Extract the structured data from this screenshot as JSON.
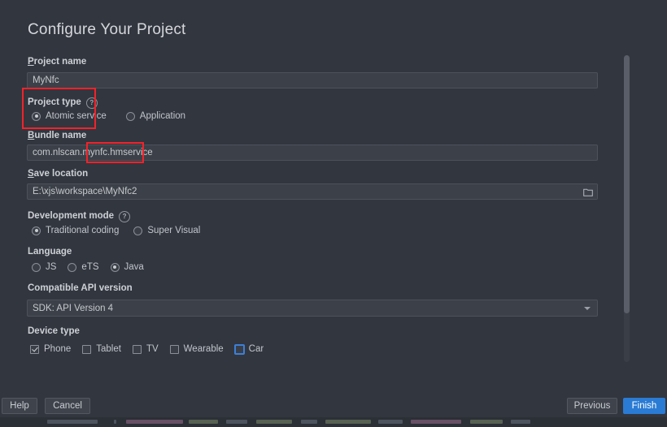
{
  "dialog": {
    "title": "Configure Your Project"
  },
  "fields": {
    "project_name": {
      "label": "Project name",
      "mnemonic": "P",
      "label_rest": "roject name",
      "value": "MyNfc"
    },
    "project_type": {
      "label": "Project type",
      "help_icon": "help-circle-icon",
      "help_glyph": "?",
      "options": [
        {
          "label": "Atomic service",
          "selected": true
        },
        {
          "label": "Application",
          "selected": false
        }
      ]
    },
    "bundle_name": {
      "label": "Bundle name",
      "mnemonic": "B",
      "label_rest": "undle name",
      "value": "com.nlscan.mynfc.hmservice"
    },
    "save_location": {
      "label": "Save location",
      "mnemonic": "S",
      "label_rest": "ave location",
      "value": "E:\\xjs\\workspace\\MyNfc2",
      "browse_icon": "folder-icon"
    },
    "development_mode": {
      "label": "Development mode",
      "help_icon": "help-circle-icon",
      "help_glyph": "?",
      "options": [
        {
          "label": "Traditional coding",
          "selected": true
        },
        {
          "label": "Super Visual",
          "selected": false
        }
      ]
    },
    "language": {
      "label": "Language",
      "options": [
        {
          "label": "JS",
          "selected": false
        },
        {
          "label": "eTS",
          "selected": false
        },
        {
          "label": "Java",
          "selected": true
        }
      ]
    },
    "compatible_api_version": {
      "label": "Compatible API version",
      "value": "SDK: API Version 4",
      "arrow_icon": "chevron-down-icon"
    },
    "device_type": {
      "label": "Device type",
      "options": [
        {
          "label": "Phone",
          "checked": true,
          "focused": false
        },
        {
          "label": "Tablet",
          "checked": false,
          "focused": false
        },
        {
          "label": "TV",
          "checked": false,
          "focused": false
        },
        {
          "label": "Wearable",
          "checked": false,
          "focused": false
        },
        {
          "label": "Car",
          "checked": false,
          "focused": true
        }
      ]
    }
  },
  "buttons": {
    "help": {
      "label": "Help",
      "mnemonic": "H",
      "label_rest": "elp"
    },
    "cancel": {
      "label": "Cancel",
      "mnemonic": "C",
      "label_rest": "ancel"
    },
    "previous": {
      "label": "Previous",
      "mnemonic": "P",
      "label_rest": "revious"
    },
    "finish": {
      "label": "Finish",
      "mnemonic": "F",
      "label_rest": "inish"
    }
  },
  "scrollbar": {
    "orientation": "vertical"
  },
  "annotations": [
    {
      "name": "project-type-highlight",
      "color": "#f3222a"
    },
    {
      "name": "bundle-name-highlight",
      "color": "#f3222a"
    }
  ]
}
